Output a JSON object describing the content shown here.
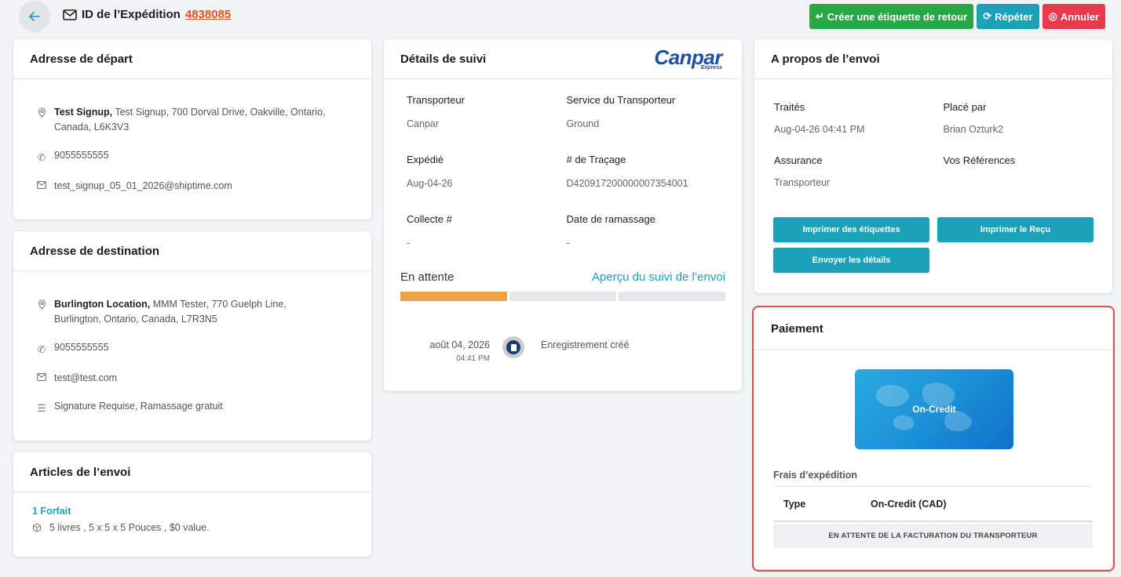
{
  "header": {
    "title_prefix": "ID de l’Expédition",
    "shipment_id": "4838085",
    "actions": {
      "return_label": "Créer une étiquette de retour",
      "repeat": "Répéter",
      "cancel": "Annuler"
    }
  },
  "departure": {
    "title": "Adresse de départ",
    "name": "Test Signup,",
    "address_line1": " Test Signup, 700 Dorval Drive, Oakville, Ontario,",
    "address_line2": "Canada, L6K3V3",
    "phone": "9055555555",
    "email": "test_signup_05_01_2026@shiptime.com"
  },
  "destination": {
    "title": "Adresse de destination",
    "name": "Burlington Location,",
    "address_line1": " MMM Tester, 770 Guelph Line,",
    "address_line2": "Burlington, Ontario, Canada, L7R3N5",
    "phone": "9055555555",
    "email": "test@test.com",
    "options": "Signature Requise, Ramassage gratuit"
  },
  "items": {
    "title": "Articles de l’envoi",
    "package_count": "1 Forfait",
    "package_desc": "5 livres , 5 x 5 x 5 Pouces , $0 value."
  },
  "tracking": {
    "title": "Détails de suivi",
    "logo_text": "Canpar",
    "logo_sub": "Express",
    "carrier_label": "Transporteur",
    "carrier_value": "Canpar",
    "service_label": "Service du Transporteur",
    "service_value": "Ground",
    "shipped_label": "Expédié",
    "shipped_value": "Aug-04-26",
    "tracking_label": "# de Traçage",
    "tracking_value": "D420917200000007354001",
    "pickup_no_label": "Collecte #",
    "pickup_no_value": "-",
    "pickup_date_label": "Date de ramassage",
    "pickup_date_value": "-",
    "status": "En attente",
    "preview_link": "Aperçu du suivi de l’envoi",
    "progress_steps_done": 1,
    "progress_steps_total": 3,
    "event_date": "août 04, 2026",
    "event_time": "04:41 PM",
    "event_text": "Enregistrement créé"
  },
  "about": {
    "title": "A propos de l’envoi",
    "processed_label": "Traités",
    "processed_value": "Aug-04-26 04:41 PM",
    "placed_by_label": "Placé par",
    "placed_by_value": "Brian Ozturk2",
    "insurance_label": "Assurance",
    "insurance_value": "Transporteur",
    "refs_label": "Vos Références",
    "print_labels": "Imprimer des étiquettes",
    "print_receipt": "Imprimer le Reçu",
    "send_details": "Envoyer les détails"
  },
  "payment": {
    "title": "Paiement",
    "card_label": "On-Credit",
    "fees_title": "Frais d’expédition",
    "type_label": "Type",
    "type_value": "On-Credit (CAD)",
    "pending_note": "EN ATTENTE DE LA FACTURATION DU TRANSPORTEUR",
    "highlight_color": "#d9534f"
  },
  "colors": {
    "teal": "#1ba2b8",
    "green": "#28a745",
    "red": "#e83a4a",
    "orange_link": "#e2541e",
    "progress": "#f0a24a"
  }
}
